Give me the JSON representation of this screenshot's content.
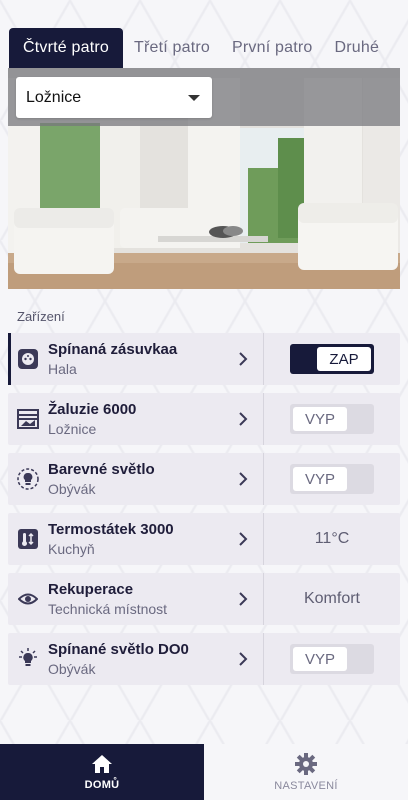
{
  "tabs": [
    {
      "label": "Čtvrté patro",
      "active": true
    },
    {
      "label": "Třetí patro",
      "active": false
    },
    {
      "label": "První patro",
      "active": false
    },
    {
      "label": "Druhé",
      "active": false
    }
  ],
  "room_select": {
    "value": "Ložnice",
    "icon": "chevron-down-icon"
  },
  "section_label": "Zařízení",
  "devices": [
    {
      "name": "Spínaná zásuvkaa",
      "room": "Hala",
      "icon": "outlet-icon",
      "control": "toggle",
      "state": "ZAP",
      "on": true
    },
    {
      "name": "Žaluzie 6000",
      "room": "Ložnice",
      "icon": "blinds-icon",
      "control": "toggle",
      "state": "VYP",
      "on": false
    },
    {
      "name": "Barevné světlo",
      "room": "Obývák",
      "icon": "color-bulb-icon",
      "control": "toggle",
      "state": "VYP",
      "on": false
    },
    {
      "name": "Termostátek 3000",
      "room": "Kuchyň",
      "icon": "thermostat-icon",
      "control": "value",
      "state": "11°C"
    },
    {
      "name": "Rekuperace",
      "room": "Technická místnost",
      "icon": "eye-icon",
      "control": "value",
      "state": "Komfort"
    },
    {
      "name": "Spínané světlo DO0",
      "room": "Obývák",
      "icon": "bulb-icon",
      "control": "toggle",
      "state": "VYP",
      "on": false
    }
  ],
  "bottom_nav": [
    {
      "label": "DOMŮ",
      "icon": "home-icon",
      "active": true
    },
    {
      "label": "NASTAVENÍ",
      "icon": "gear-icon",
      "active": false
    }
  ],
  "colors": {
    "accent": "#171a3a",
    "row_bg": "#eceaf1",
    "page_bg": "#f6f6f9"
  }
}
